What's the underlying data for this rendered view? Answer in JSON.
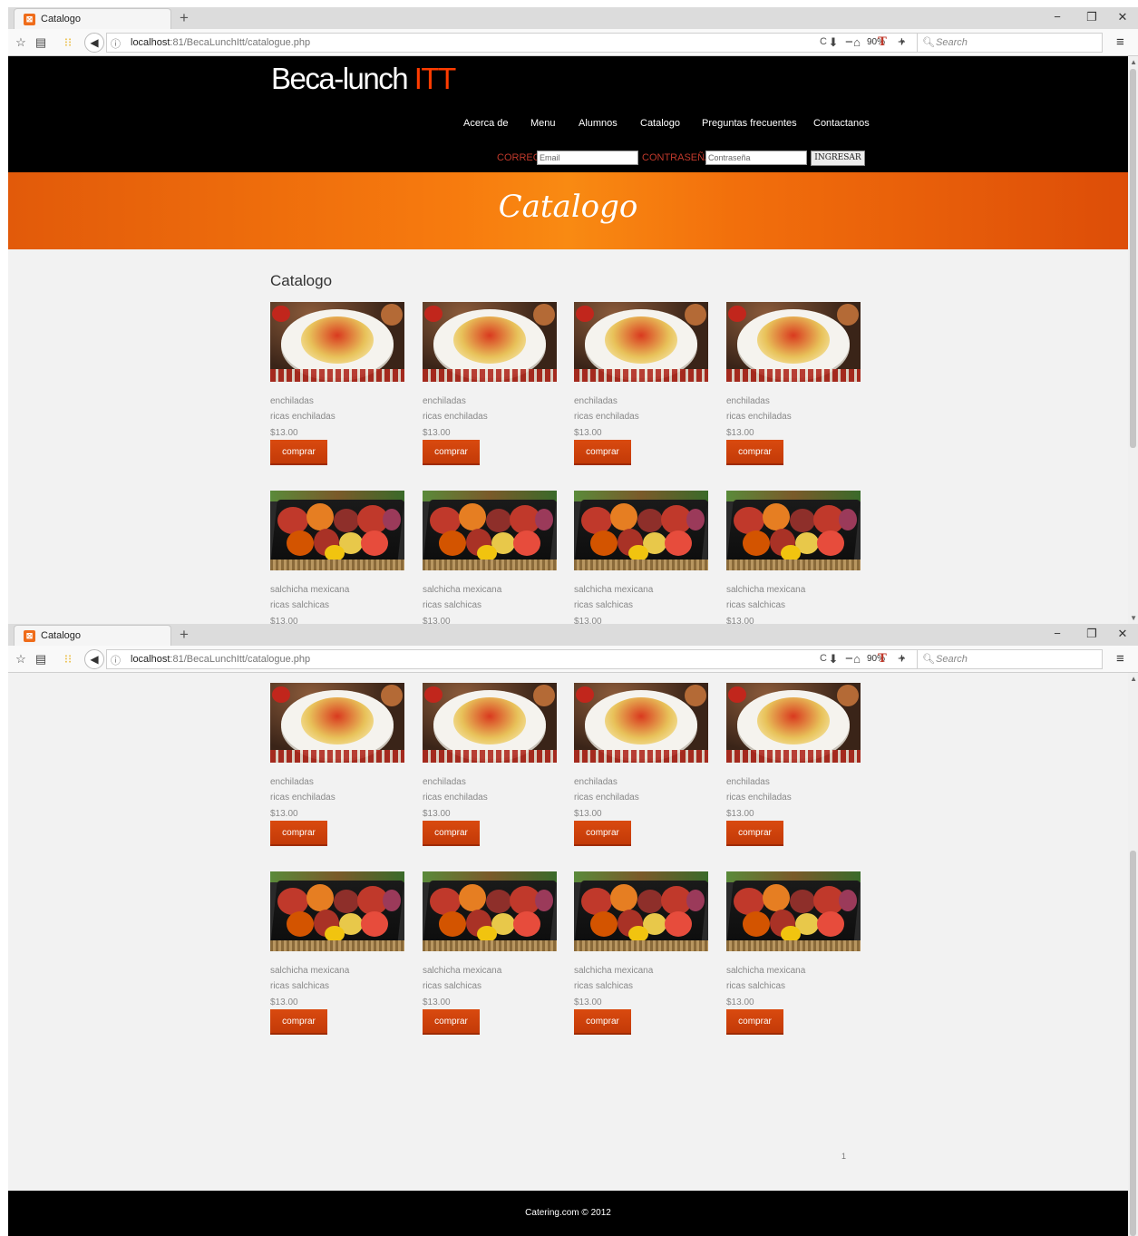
{
  "browser": {
    "tab_title": "Catalogo",
    "new_tab": "+",
    "url_info": "ⓘ",
    "url_host": "localhost",
    "url_rest": ":81/BecaLunchItt/catalogue.php",
    "reload": "C",
    "zoom_minus": "−",
    "zoom_level": "90%",
    "zoom_plus": "+",
    "search_placeholder": "Search",
    "minimize": "−",
    "restore": "❐",
    "close": "✕"
  },
  "site": {
    "logo_main": "Beca-lunch ",
    "logo_accent": "ITT",
    "menu": [
      "Acerca de",
      "Menu",
      "Alumnos",
      "Catalogo",
      "Preguntas frecuentes",
      "Contactanos"
    ],
    "login": {
      "email_label": "CORREO",
      "email_placeholder": "Email",
      "password_label": "CONTRASEÑA",
      "password_placeholder": "Contraseña",
      "button": "INGRESAR"
    },
    "banner_title": "Catalogo",
    "section_title": "Catalogo",
    "products": [
      {
        "name": "enchiladas",
        "desc": "ricas enchiladas",
        "price": "$13.00",
        "button": "comprar"
      },
      {
        "name": "enchiladas",
        "desc": "ricas enchiladas",
        "price": "$13.00",
        "button": "comprar"
      },
      {
        "name": "enchiladas",
        "desc": "ricas enchiladas",
        "price": "$13.00",
        "button": "comprar"
      },
      {
        "name": "enchiladas",
        "desc": "ricas enchiladas",
        "price": "$13.00",
        "button": "comprar"
      },
      {
        "name": "salchicha mexicana",
        "desc": "ricas salchicas",
        "price": "$13.00",
        "button": "comprar"
      },
      {
        "name": "salchicha mexicana",
        "desc": "ricas salchicas",
        "price": "$13.00",
        "button": "comprar"
      },
      {
        "name": "salchicha mexicana",
        "desc": "ricas salchicas",
        "price": "$13.00",
        "button": "comprar"
      },
      {
        "name": "salchicha mexicana",
        "desc": "ricas salchicas",
        "price": "$13.00",
        "button": "comprar"
      }
    ],
    "pagination": "1",
    "footer": "Catering.com © 2012"
  },
  "colors": {
    "header_bg": "#000000",
    "accent": "#ff3c00",
    "button": "#d0420c",
    "banner": "#f77b0e"
  }
}
